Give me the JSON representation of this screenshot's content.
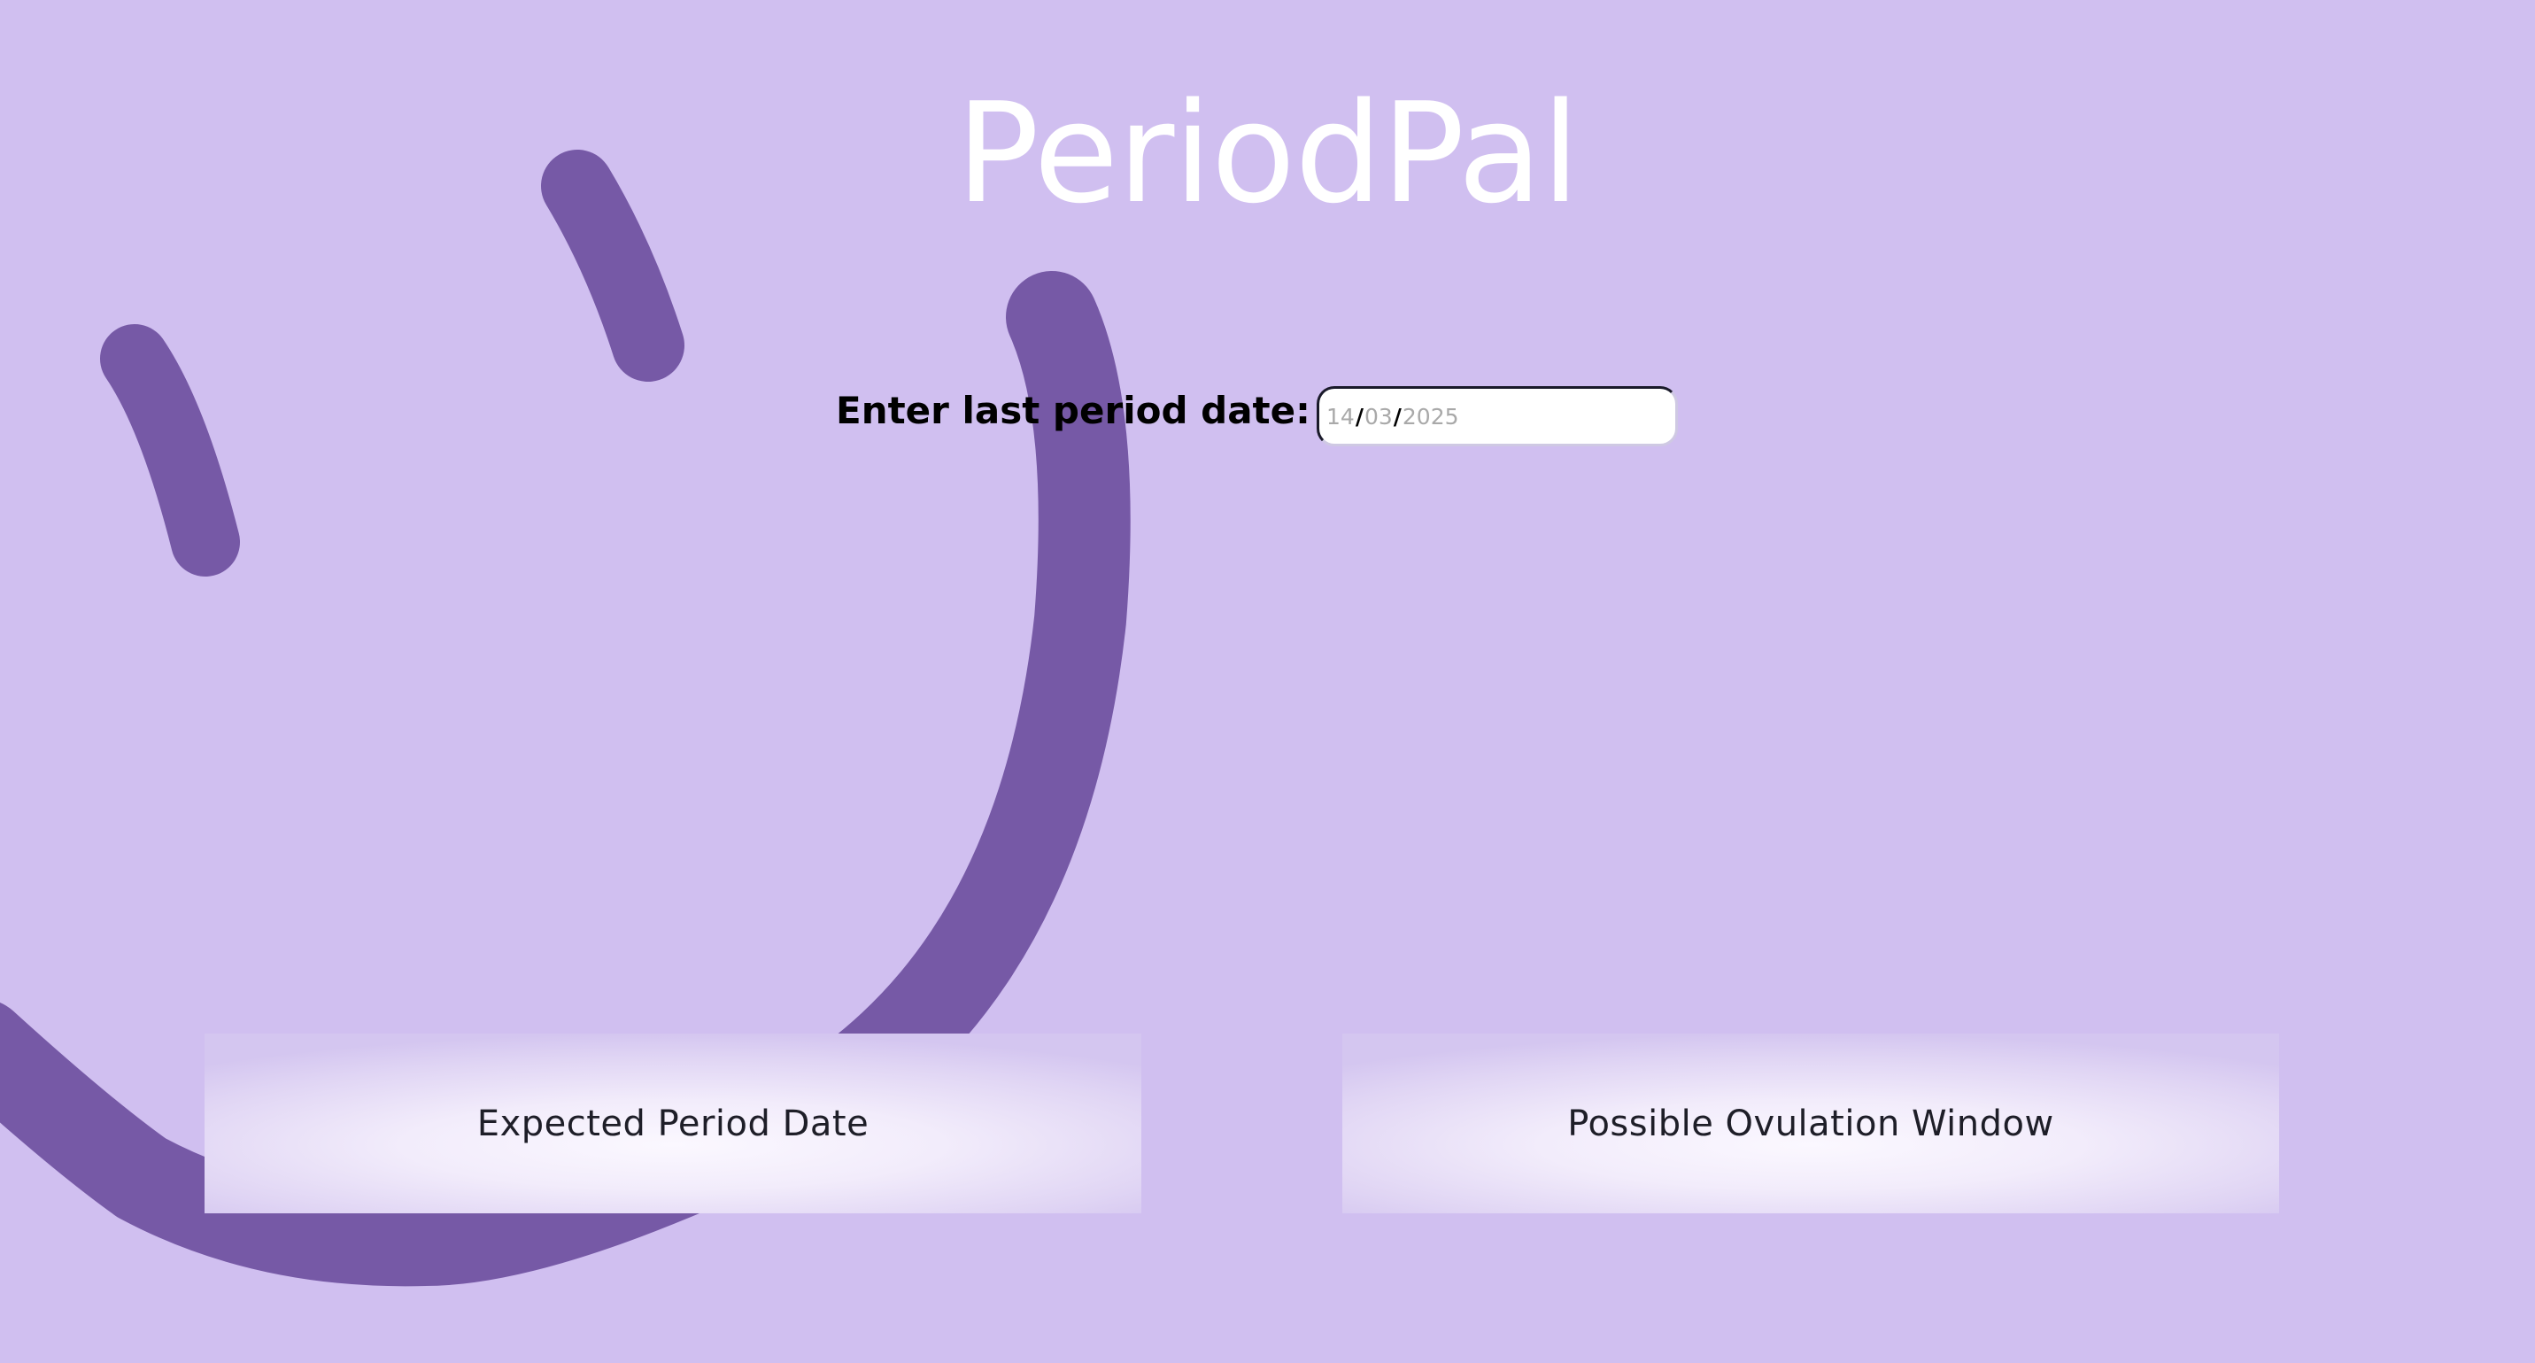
{
  "app": {
    "title": "PeriodPal"
  },
  "form": {
    "label": "Enter last period date:",
    "date_day": "14",
    "date_month": "03",
    "date_year": "2025",
    "date_separator": "/"
  },
  "results": {
    "expected_period_label": "Expected Period Date",
    "ovulation_window_label": "Possible Ovulation Window"
  },
  "colors": {
    "background": "#d0bff0",
    "decoration": "#7659a6",
    "title": "#ffffff"
  },
  "icons": {
    "background_art": "smiley-face-icon"
  }
}
